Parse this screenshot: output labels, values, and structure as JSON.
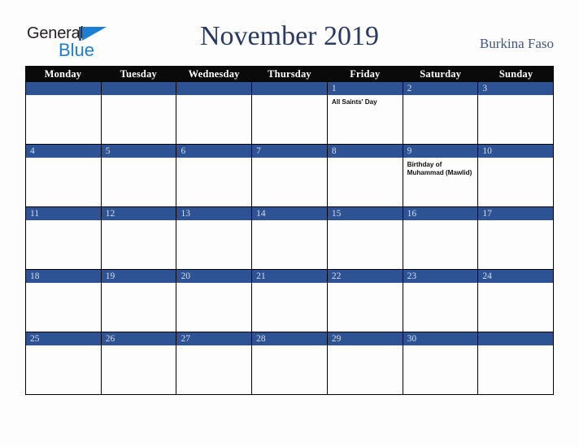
{
  "brand": {
    "name_part1": "General",
    "name_part2": "Blue",
    "mark": "triangle-logo"
  },
  "header": {
    "title": "November 2019",
    "country": "Burkina Faso"
  },
  "calendar": {
    "weekdays": [
      "Monday",
      "Tuesday",
      "Wednesday",
      "Thursday",
      "Friday",
      "Saturday",
      "Sunday"
    ],
    "colors": {
      "weekday_header_bg": "#0a0a0a",
      "weekday_header_text": "#ffffff",
      "daynum_bg": "#2e5395",
      "daynum_text": "#d6dce9",
      "cell_bg": "#fdfdfd",
      "grid_line": "#000000",
      "title_text": "#2b3a63",
      "country_text": "#44557e",
      "brand_blue": "#1b7fd4",
      "page_bg": "#fdfdfd"
    },
    "weeks": [
      [
        {
          "num": "",
          "events": []
        },
        {
          "num": "",
          "events": []
        },
        {
          "num": "",
          "events": []
        },
        {
          "num": "",
          "events": []
        },
        {
          "num": "1",
          "events": [
            "All Saints' Day"
          ]
        },
        {
          "num": "2",
          "events": []
        },
        {
          "num": "3",
          "events": []
        }
      ],
      [
        {
          "num": "4",
          "events": []
        },
        {
          "num": "5",
          "events": []
        },
        {
          "num": "6",
          "events": []
        },
        {
          "num": "7",
          "events": []
        },
        {
          "num": "8",
          "events": []
        },
        {
          "num": "9",
          "events": [
            "Birthday of Muhammad (Mawlid)"
          ]
        },
        {
          "num": "10",
          "events": []
        }
      ],
      [
        {
          "num": "11",
          "events": []
        },
        {
          "num": "12",
          "events": []
        },
        {
          "num": "13",
          "events": []
        },
        {
          "num": "14",
          "events": []
        },
        {
          "num": "15",
          "events": []
        },
        {
          "num": "16",
          "events": []
        },
        {
          "num": "17",
          "events": []
        }
      ],
      [
        {
          "num": "18",
          "events": []
        },
        {
          "num": "19",
          "events": []
        },
        {
          "num": "20",
          "events": []
        },
        {
          "num": "21",
          "events": []
        },
        {
          "num": "22",
          "events": []
        },
        {
          "num": "23",
          "events": []
        },
        {
          "num": "24",
          "events": []
        }
      ],
      [
        {
          "num": "25",
          "events": []
        },
        {
          "num": "26",
          "events": []
        },
        {
          "num": "27",
          "events": []
        },
        {
          "num": "28",
          "events": []
        },
        {
          "num": "29",
          "events": []
        },
        {
          "num": "30",
          "events": []
        },
        {
          "num": "",
          "events": []
        }
      ]
    ]
  }
}
